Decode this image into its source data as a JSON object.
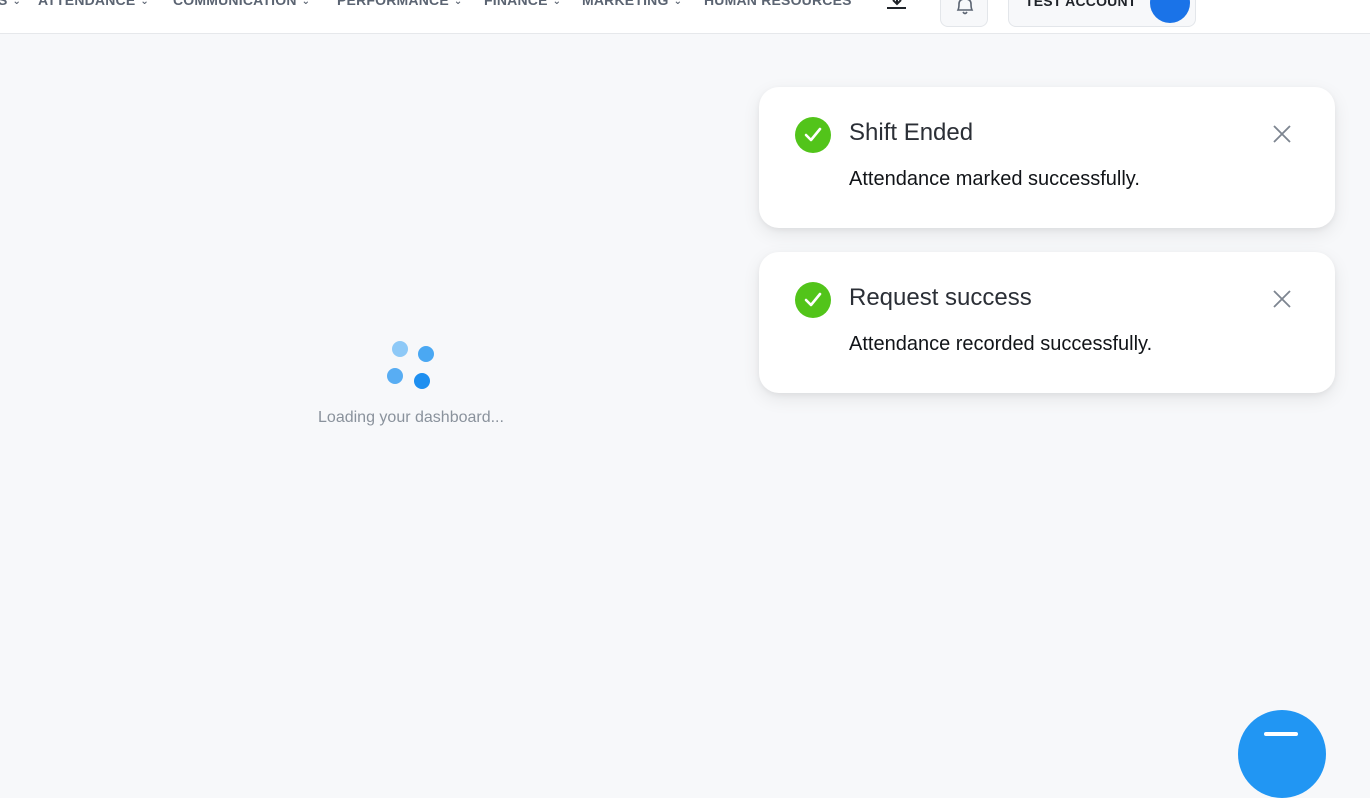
{
  "nav": {
    "items": [
      {
        "label": "S"
      },
      {
        "label": "ATTENDANCE"
      },
      {
        "label": "COMMUNICATION"
      },
      {
        "label": "PERFORMANCE"
      },
      {
        "label": "FINANCE"
      },
      {
        "label": "MARKETING"
      },
      {
        "label": "HUMAN RESOURCES"
      }
    ],
    "chevron": "⌄"
  },
  "header": {
    "account_name": "TEST ACCOUNT",
    "icons": [
      "download-icon",
      "bell-icon"
    ]
  },
  "loader": {
    "text": "Loading your dashboard..."
  },
  "toasts": [
    {
      "title": "Shift Ended",
      "message": "Attendance marked successfully."
    },
    {
      "title": "Request success",
      "message": "Attendance recorded successfully."
    }
  ],
  "colors": {
    "success": "#52c41a",
    "accent": "#2196f3",
    "loader_dots": [
      "#8ec9f7",
      "#4aa8f3",
      "#58adf3",
      "#1e8ff0"
    ]
  }
}
